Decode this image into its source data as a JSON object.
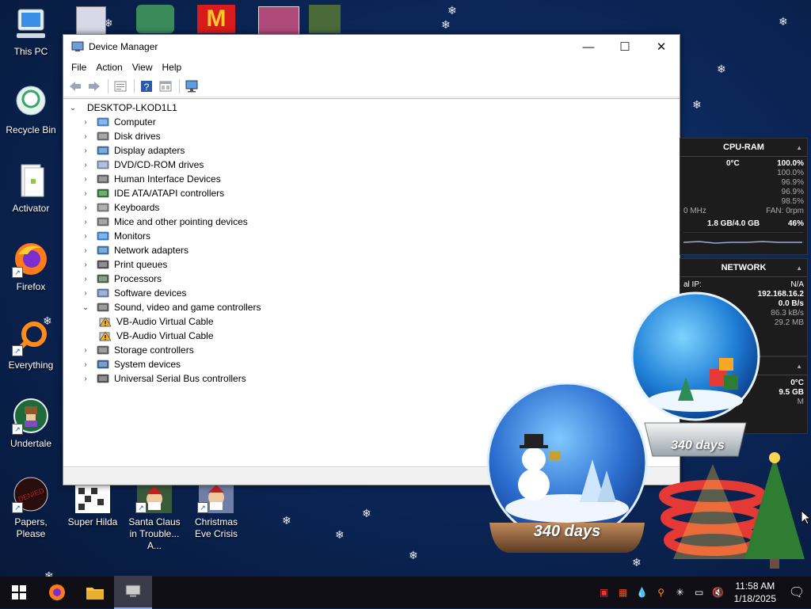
{
  "desktop": {
    "icons": [
      {
        "label": "This PC"
      },
      {
        "label": "Recycle Bin"
      },
      {
        "label": "Activator"
      },
      {
        "label": "Firefox"
      },
      {
        "label": "Everything"
      },
      {
        "label": "Undertale"
      },
      {
        "label": "Papers, Please"
      },
      {
        "label": "Super Hilda"
      },
      {
        "label": "Santa Claus in Trouble... A..."
      },
      {
        "label": "Christmas Eve Crisis"
      }
    ]
  },
  "window": {
    "title": "Device Manager",
    "menu": [
      "File",
      "Action",
      "View",
      "Help"
    ],
    "tree": {
      "root": "DESKTOP-LKOD1L1",
      "items": [
        {
          "label": "Computer",
          "icon": "computer-icon",
          "expanded": false
        },
        {
          "label": "Disk drives",
          "icon": "disk-drive-icon",
          "expanded": false
        },
        {
          "label": "Display adapters",
          "icon": "display-adapter-icon",
          "expanded": false
        },
        {
          "label": "DVD/CD-ROM drives",
          "icon": "dvd-icon",
          "expanded": false
        },
        {
          "label": "Human Interface Devices",
          "icon": "hid-icon",
          "expanded": false
        },
        {
          "label": "IDE ATA/ATAPI controllers",
          "icon": "ide-icon",
          "expanded": false
        },
        {
          "label": "Keyboards",
          "icon": "keyboard-icon",
          "expanded": false
        },
        {
          "label": "Mice and other pointing devices",
          "icon": "mouse-icon",
          "expanded": false
        },
        {
          "label": "Monitors",
          "icon": "monitor-icon",
          "expanded": false
        },
        {
          "label": "Network adapters",
          "icon": "network-adapter-icon",
          "expanded": false
        },
        {
          "label": "Print queues",
          "icon": "printer-icon",
          "expanded": false
        },
        {
          "label": "Processors",
          "icon": "processor-icon",
          "expanded": false
        },
        {
          "label": "Software devices",
          "icon": "software-device-icon",
          "expanded": false
        },
        {
          "label": "Sound, video and game controllers",
          "icon": "speaker-icon",
          "expanded": true
        },
        {
          "label": "VB-Audio Virtual Cable",
          "icon": "warning-device-icon",
          "child": true
        },
        {
          "label": "VB-Audio Virtual Cable",
          "icon": "warning-device-icon",
          "child": true
        },
        {
          "label": "Storage controllers",
          "icon": "storage-icon",
          "expanded": false
        },
        {
          "label": "System devices",
          "icon": "system-device-icon",
          "expanded": false
        },
        {
          "label": "Universal Serial Bus controllers",
          "icon": "usb-icon",
          "expanded": false
        }
      ]
    }
  },
  "gadgets": {
    "cpu_ram": {
      "title": "CPU-RAM",
      "temp": "0°C",
      "total": "100.0%",
      "cores": [
        "100.0%",
        "96.9%",
        "96.9%",
        "98.5%"
      ],
      "mhz": "0 MHz",
      "fan": "FAN: 0rpm",
      "ram": "1.8 GB/4.0 GB",
      "ram_pct": "46%"
    },
    "network": {
      "title": "NETWORK",
      "ext_ip_label": "al IP:",
      "ext_ip": "N/A",
      "local_ip": "192.168.16.2",
      "rate": "0.0 B/s",
      "up": "86.3 kB/s",
      "total": "29.2 MB"
    },
    "third": {
      "temp": "0°C",
      "size": "9.5 GB",
      "unit": "M"
    }
  },
  "snowglobes": {
    "small_label": "340 days",
    "large_label": "340 days"
  },
  "taskbar": {
    "time": "11:58 AM",
    "date": "1/18/2025"
  },
  "colors": {
    "desktop_bg": "#0b2658",
    "taskbar_bg": "#0e0e14",
    "gadget_bg": "#1c1c1c"
  }
}
